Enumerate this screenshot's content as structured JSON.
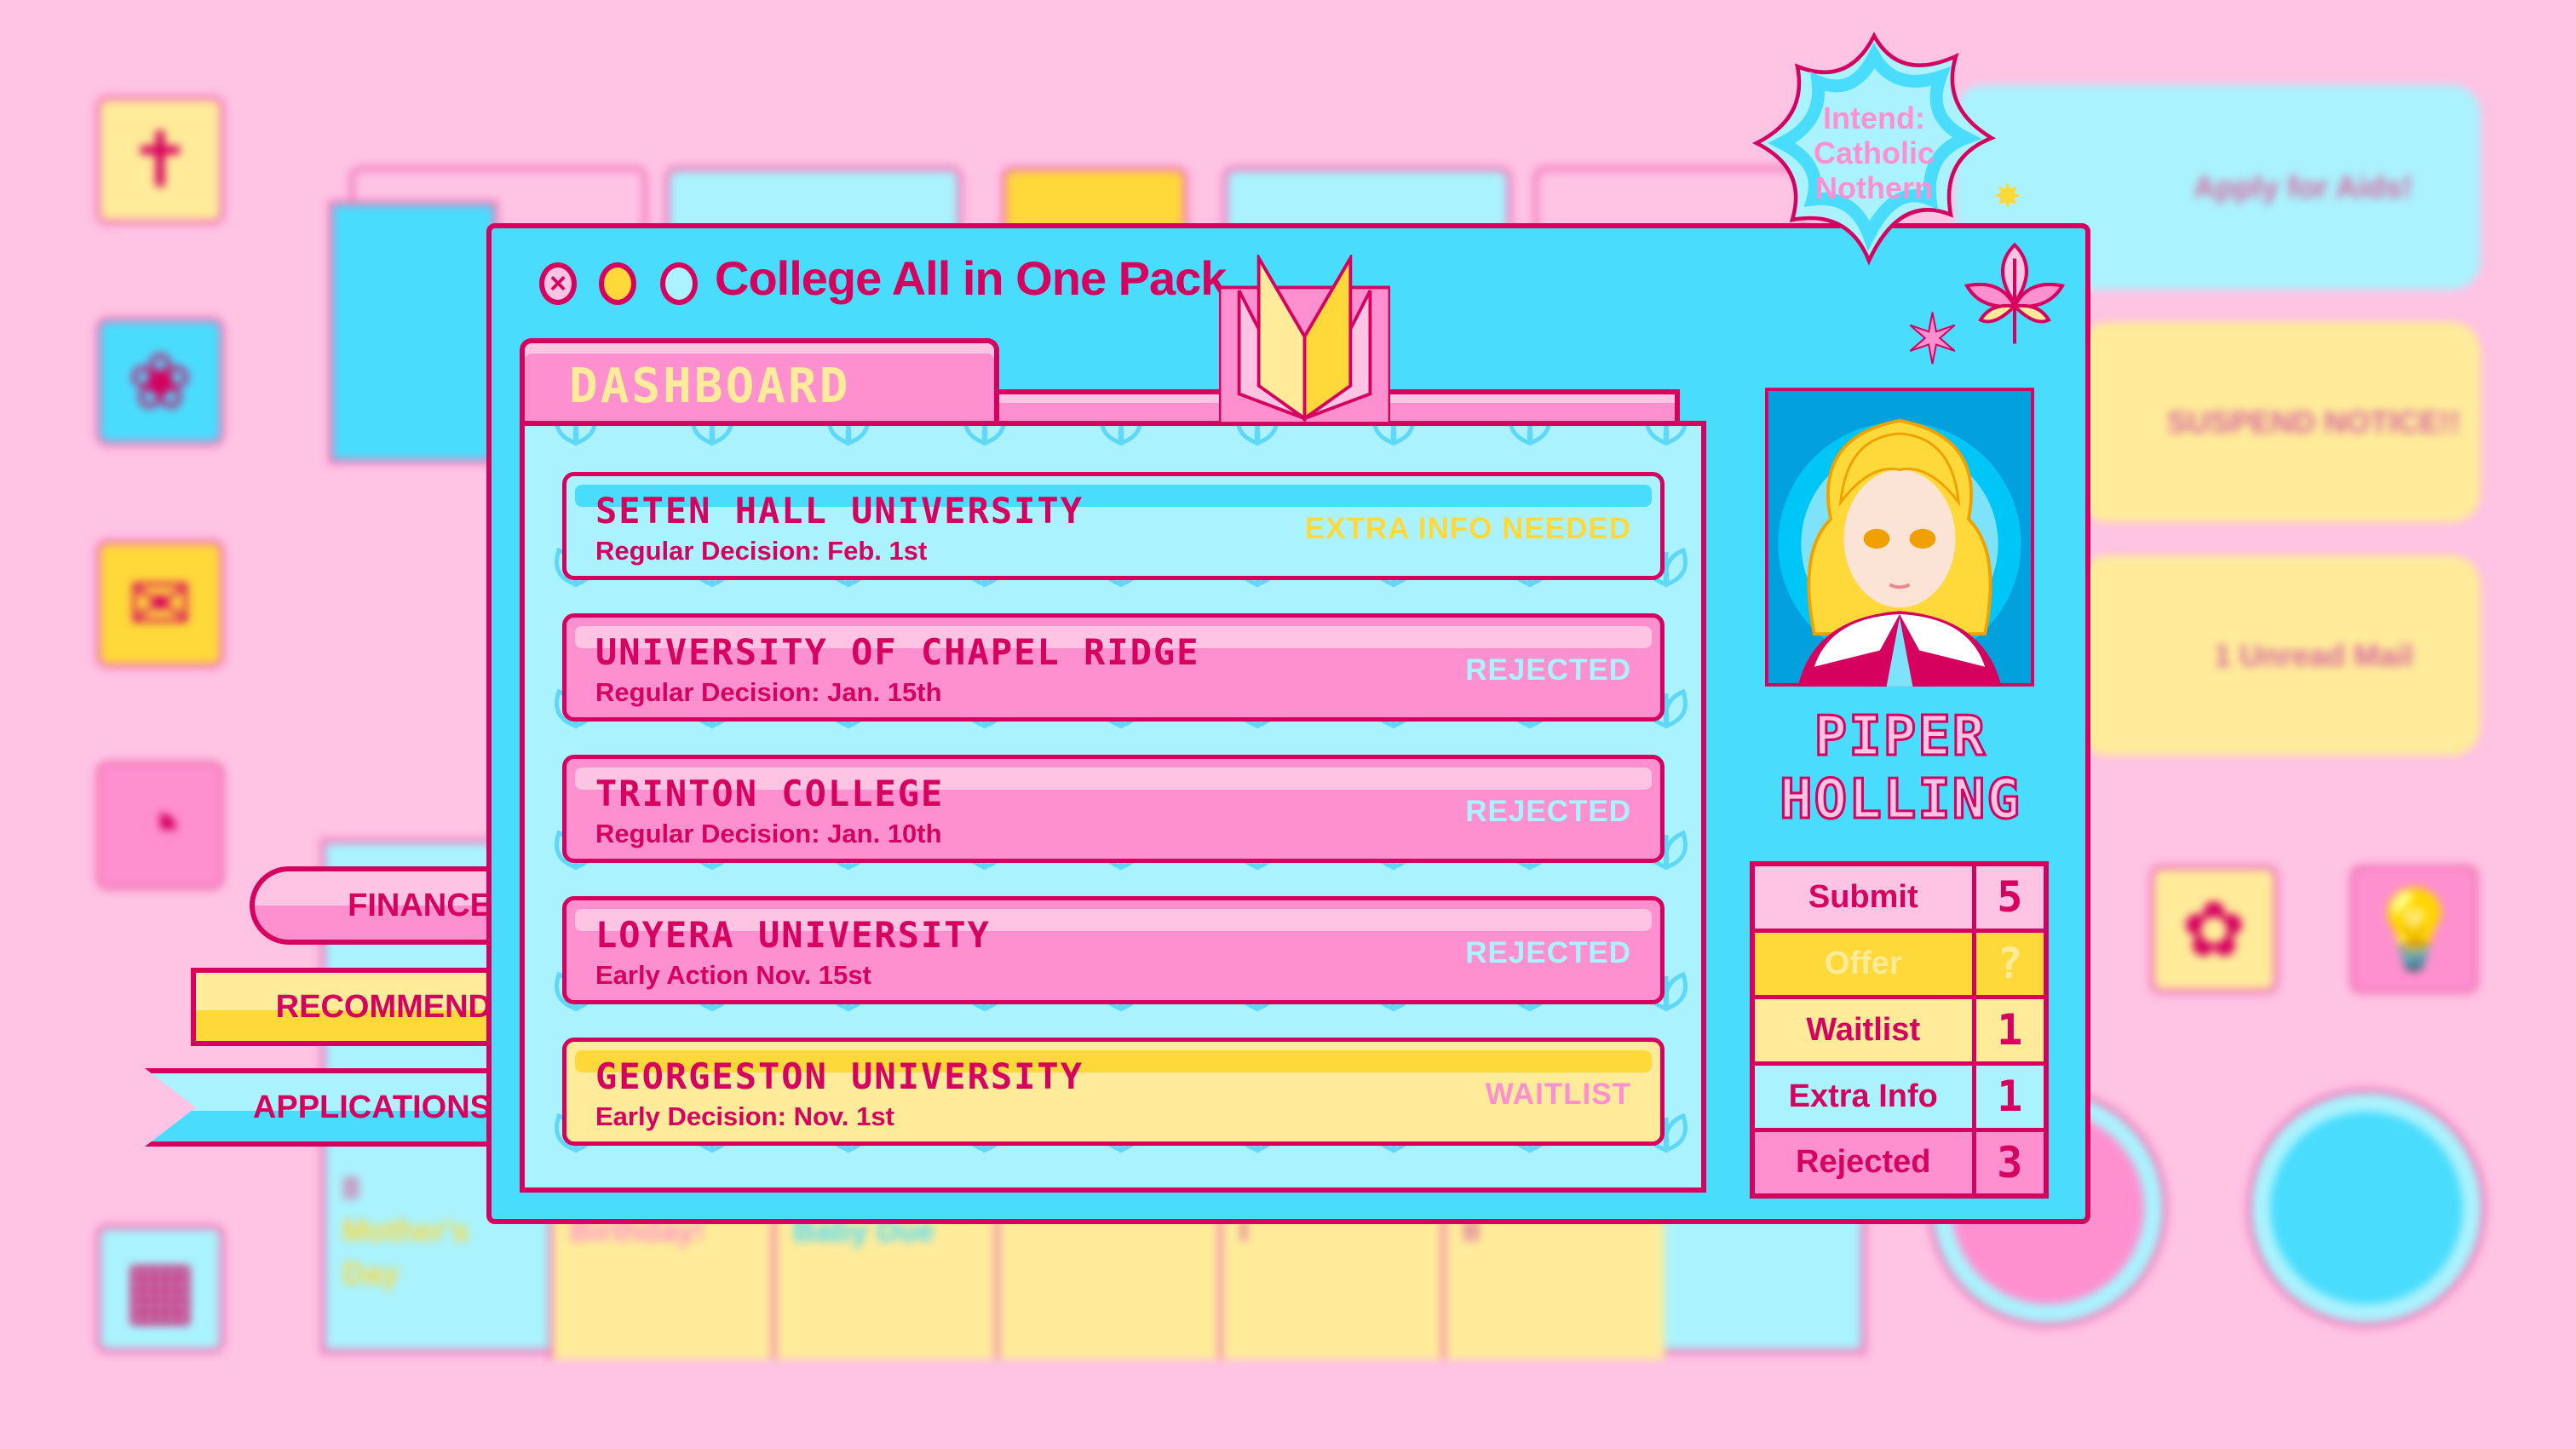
{
  "window": {
    "title": "College All in One Pack",
    "tab": "DASHBOARD",
    "controls": [
      "close",
      "minimize",
      "maximize"
    ]
  },
  "applications": [
    {
      "school": "SETEN HALL UNIVERSITY",
      "deadline": "Regular Decision: Feb. 1st",
      "status": "EXTRA INFO NEEDED",
      "theme": "blue"
    },
    {
      "school": "UNIVERSITY OF CHAPEL RIDGE",
      "deadline": "Regular Decision: Jan. 15th",
      "status": "REJECTED",
      "theme": "pink"
    },
    {
      "school": "TRINTON COLLEGE",
      "deadline": "Regular Decision: Jan. 10th",
      "status": "REJECTED",
      "theme": "pink"
    },
    {
      "school": "LOYERA UNIVERSITY",
      "deadline": "Early Action Nov. 15st",
      "status": "REJECTED",
      "theme": "pink"
    },
    {
      "school": "GEORGESTON UNIVERSITY",
      "deadline": "Early Decision: Nov. 1st",
      "status": "WAITLIST",
      "theme": "yellow"
    }
  ],
  "side_tabs": {
    "finance": "FINANCE",
    "recommend": "RECOMMEND",
    "applications": "APPLICATIONS"
  },
  "profile": {
    "badge": "Intend: Catholic Nothern",
    "first_name": "PIPER",
    "last_name": "HOLLING"
  },
  "stats": [
    {
      "label": "Submit",
      "value": "5"
    },
    {
      "label": "Offer",
      "value": "?"
    },
    {
      "label": "Waitlist",
      "value": "1"
    },
    {
      "label": "Extra Info",
      "value": "1"
    },
    {
      "label": "Rejected",
      "value": "3"
    }
  ],
  "background": {
    "panels": [
      "Apply for Aids!",
      "SUSPEND NOTICE!!",
      "1 Unread Mail"
    ],
    "calendar": {
      "day": "8",
      "events": [
        "Mother's Day",
        "Birthday!",
        "Baby Due",
        "",
        "Senior Final I",
        "Senior Final II"
      ]
    }
  },
  "colors": {
    "outline": "#d6005f",
    "cyan": "#4adcfd",
    "light_cyan": "#aaf2fd",
    "pink": "#ff90cf",
    "light_pink": "#ffc3e4",
    "yellow": "#ffd83a",
    "light_yellow": "#ffeb9a"
  }
}
